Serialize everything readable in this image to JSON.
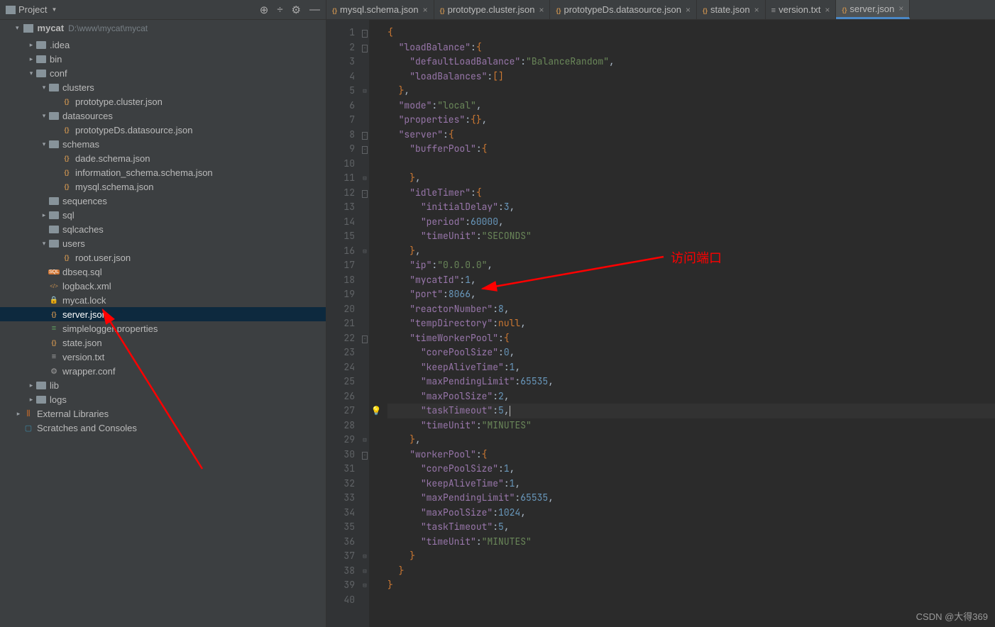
{
  "sidebar": {
    "title": "Project",
    "project_name": "mycat",
    "project_path": "D:\\www\\mycat\\mycat",
    "tree": [
      {
        "d": 1,
        "t": "folder",
        "label": ".idea",
        "exp": "right"
      },
      {
        "d": 1,
        "t": "folder",
        "label": "bin",
        "exp": "right"
      },
      {
        "d": 1,
        "t": "folder",
        "label": "conf",
        "exp": "down"
      },
      {
        "d": 2,
        "t": "folder",
        "label": "clusters",
        "exp": "down"
      },
      {
        "d": 3,
        "t": "json",
        "label": "prototype.cluster.json"
      },
      {
        "d": 2,
        "t": "folder",
        "label": "datasources",
        "exp": "down"
      },
      {
        "d": 3,
        "t": "json",
        "label": "prototypeDs.datasource.json"
      },
      {
        "d": 2,
        "t": "folder",
        "label": "schemas",
        "exp": "down"
      },
      {
        "d": 3,
        "t": "json",
        "label": "dade.schema.json"
      },
      {
        "d": 3,
        "t": "json",
        "label": "information_schema.schema.json"
      },
      {
        "d": 3,
        "t": "json",
        "label": "mysql.schema.json"
      },
      {
        "d": 2,
        "t": "folder",
        "label": "sequences"
      },
      {
        "d": 2,
        "t": "folder",
        "label": "sql",
        "exp": "right"
      },
      {
        "d": 2,
        "t": "folder",
        "label": "sqlcaches"
      },
      {
        "d": 2,
        "t": "folder",
        "label": "users",
        "exp": "down"
      },
      {
        "d": 3,
        "t": "json",
        "label": "root.user.json"
      },
      {
        "d": 2,
        "t": "sql",
        "label": "dbseq.sql"
      },
      {
        "d": 2,
        "t": "xml",
        "label": "logback.xml"
      },
      {
        "d": 2,
        "t": "lock",
        "label": "mycat.lock"
      },
      {
        "d": 2,
        "t": "json",
        "label": "server.json",
        "selected": true
      },
      {
        "d": 2,
        "t": "props",
        "label": "simplelogger.properties"
      },
      {
        "d": 2,
        "t": "json",
        "label": "state.json"
      },
      {
        "d": 2,
        "t": "txt",
        "label": "version.txt"
      },
      {
        "d": 2,
        "t": "conf",
        "label": "wrapper.conf"
      },
      {
        "d": 1,
        "t": "folder",
        "label": "lib",
        "exp": "right"
      },
      {
        "d": 1,
        "t": "folder",
        "label": "logs",
        "exp": "right"
      },
      {
        "d": 0,
        "t": "lib",
        "label": "External Libraries",
        "exp": "right"
      },
      {
        "d": 0,
        "t": "scratch",
        "label": "Scratches and Consoles"
      }
    ]
  },
  "tabs": [
    {
      "label": "mysql.schema.json",
      "type": "json"
    },
    {
      "label": "prototype.cluster.json",
      "type": "json"
    },
    {
      "label": "prototypeDs.datasource.json",
      "type": "json"
    },
    {
      "label": "state.json",
      "type": "json"
    },
    {
      "label": "version.txt",
      "type": "txt"
    },
    {
      "label": "server.json",
      "type": "json",
      "active": true
    }
  ],
  "editor": {
    "bulb_line": 27,
    "highlight_line": 27,
    "lines": [
      [
        [
          "p",
          "{"
        ]
      ],
      [
        [
          "sp",
          "  "
        ],
        [
          "k",
          "\"loadBalance\""
        ],
        [
          "p2",
          ":"
        ],
        [
          "p",
          "{"
        ]
      ],
      [
        [
          "sp",
          "    "
        ],
        [
          "k",
          "\"defaultLoadBalance\""
        ],
        [
          "p2",
          ":"
        ],
        [
          "s",
          "\"BalanceRandom\""
        ],
        [
          "p2",
          ","
        ]
      ],
      [
        [
          "sp",
          "    "
        ],
        [
          "k",
          "\"loadBalances\""
        ],
        [
          "p2",
          ":"
        ],
        [
          "p",
          "[]"
        ]
      ],
      [
        [
          "sp",
          "  "
        ],
        [
          "p",
          "}"
        ],
        [
          "p2",
          ","
        ]
      ],
      [
        [
          "sp",
          "  "
        ],
        [
          "k",
          "\"mode\""
        ],
        [
          "p2",
          ":"
        ],
        [
          "s",
          "\"local\""
        ],
        [
          "p2",
          ","
        ]
      ],
      [
        [
          "sp",
          "  "
        ],
        [
          "k",
          "\"properties\""
        ],
        [
          "p2",
          ":"
        ],
        [
          "p",
          "{}"
        ],
        [
          "p2",
          ","
        ]
      ],
      [
        [
          "sp",
          "  "
        ],
        [
          "k",
          "\"server\""
        ],
        [
          "p2",
          ":"
        ],
        [
          "p",
          "{"
        ]
      ],
      [
        [
          "sp",
          "    "
        ],
        [
          "k",
          "\"bufferPool\""
        ],
        [
          "p2",
          ":"
        ],
        [
          "p",
          "{"
        ]
      ],
      [],
      [
        [
          "sp",
          "    "
        ],
        [
          "p",
          "}"
        ],
        [
          "p2",
          ","
        ]
      ],
      [
        [
          "sp",
          "    "
        ],
        [
          "k",
          "\"idleTimer\""
        ],
        [
          "p2",
          ":"
        ],
        [
          "p",
          "{"
        ]
      ],
      [
        [
          "sp",
          "      "
        ],
        [
          "k",
          "\"initialDelay\""
        ],
        [
          "p2",
          ":"
        ],
        [
          "n",
          "3"
        ],
        [
          "p2",
          ","
        ]
      ],
      [
        [
          "sp",
          "      "
        ],
        [
          "k",
          "\"period\""
        ],
        [
          "p2",
          ":"
        ],
        [
          "n",
          "60000"
        ],
        [
          "p2",
          ","
        ]
      ],
      [
        [
          "sp",
          "      "
        ],
        [
          "k",
          "\"timeUnit\""
        ],
        [
          "p2",
          ":"
        ],
        [
          "s",
          "\"SECONDS\""
        ]
      ],
      [
        [
          "sp",
          "    "
        ],
        [
          "p",
          "}"
        ],
        [
          "p2",
          ","
        ]
      ],
      [
        [
          "sp",
          "    "
        ],
        [
          "k",
          "\"ip\""
        ],
        [
          "p2",
          ":"
        ],
        [
          "s",
          "\"0.0.0.0\""
        ],
        [
          "p2",
          ","
        ]
      ],
      [
        [
          "sp",
          "    "
        ],
        [
          "k",
          "\"mycatId\""
        ],
        [
          "p2",
          ":"
        ],
        [
          "n",
          "1"
        ],
        [
          "p2",
          ","
        ]
      ],
      [
        [
          "sp",
          "    "
        ],
        [
          "k",
          "\"port\""
        ],
        [
          "p2",
          ":"
        ],
        [
          "n",
          "8066"
        ],
        [
          "p2",
          ","
        ]
      ],
      [
        [
          "sp",
          "    "
        ],
        [
          "k",
          "\"reactorNumber\""
        ],
        [
          "p2",
          ":"
        ],
        [
          "n",
          "8"
        ],
        [
          "p2",
          ","
        ]
      ],
      [
        [
          "sp",
          "    "
        ],
        [
          "k",
          "\"tempDirectory\""
        ],
        [
          "p2",
          ":"
        ],
        [
          "nl",
          "null"
        ],
        [
          "p2",
          ","
        ]
      ],
      [
        [
          "sp",
          "    "
        ],
        [
          "k",
          "\"timeWorkerPool\""
        ],
        [
          "p2",
          ":"
        ],
        [
          "p",
          "{"
        ]
      ],
      [
        [
          "sp",
          "      "
        ],
        [
          "k",
          "\"corePoolSize\""
        ],
        [
          "p2",
          ":"
        ],
        [
          "n",
          "0"
        ],
        [
          "p2",
          ","
        ]
      ],
      [
        [
          "sp",
          "      "
        ],
        [
          "k",
          "\"keepAliveTime\""
        ],
        [
          "p2",
          ":"
        ],
        [
          "n",
          "1"
        ],
        [
          "p2",
          ","
        ]
      ],
      [
        [
          "sp",
          "      "
        ],
        [
          "k",
          "\"maxPendingLimit\""
        ],
        [
          "p2",
          ":"
        ],
        [
          "n",
          "65535"
        ],
        [
          "p2",
          ","
        ]
      ],
      [
        [
          "sp",
          "      "
        ],
        [
          "k",
          "\"maxPoolSize\""
        ],
        [
          "p2",
          ":"
        ],
        [
          "n",
          "2"
        ],
        [
          "p2",
          ","
        ]
      ],
      [
        [
          "sp",
          "      "
        ],
        [
          "k",
          "\"taskTimeout\""
        ],
        [
          "p2",
          ":"
        ],
        [
          "n",
          "5"
        ],
        [
          "p2",
          ","
        ],
        [
          "c",
          "|"
        ]
      ],
      [
        [
          "sp",
          "      "
        ],
        [
          "k",
          "\"timeUnit\""
        ],
        [
          "p2",
          ":"
        ],
        [
          "s",
          "\"MINUTES\""
        ]
      ],
      [
        [
          "sp",
          "    "
        ],
        [
          "p",
          "}"
        ],
        [
          "p2",
          ","
        ]
      ],
      [
        [
          "sp",
          "    "
        ],
        [
          "k",
          "\"workerPool\""
        ],
        [
          "p2",
          ":"
        ],
        [
          "p",
          "{"
        ]
      ],
      [
        [
          "sp",
          "      "
        ],
        [
          "k",
          "\"corePoolSize\""
        ],
        [
          "p2",
          ":"
        ],
        [
          "n",
          "1"
        ],
        [
          "p2",
          ","
        ]
      ],
      [
        [
          "sp",
          "      "
        ],
        [
          "k",
          "\"keepAliveTime\""
        ],
        [
          "p2",
          ":"
        ],
        [
          "n",
          "1"
        ],
        [
          "p2",
          ","
        ]
      ],
      [
        [
          "sp",
          "      "
        ],
        [
          "k",
          "\"maxPendingLimit\""
        ],
        [
          "p2",
          ":"
        ],
        [
          "n",
          "65535"
        ],
        [
          "p2",
          ","
        ]
      ],
      [
        [
          "sp",
          "      "
        ],
        [
          "k",
          "\"maxPoolSize\""
        ],
        [
          "p2",
          ":"
        ],
        [
          "n",
          "1024"
        ],
        [
          "p2",
          ","
        ]
      ],
      [
        [
          "sp",
          "      "
        ],
        [
          "k",
          "\"taskTimeout\""
        ],
        [
          "p2",
          ":"
        ],
        [
          "n",
          "5"
        ],
        [
          "p2",
          ","
        ]
      ],
      [
        [
          "sp",
          "      "
        ],
        [
          "k",
          "\"timeUnit\""
        ],
        [
          "p2",
          ":"
        ],
        [
          "s",
          "\"MINUTES\""
        ]
      ],
      [
        [
          "sp",
          "    "
        ],
        [
          "p",
          "}"
        ]
      ],
      [
        [
          "sp",
          "  "
        ],
        [
          "p",
          "}"
        ]
      ],
      [
        [
          "p",
          "}"
        ]
      ],
      []
    ]
  },
  "annotation_text": "访问端口",
  "watermark": "CSDN @大得369"
}
